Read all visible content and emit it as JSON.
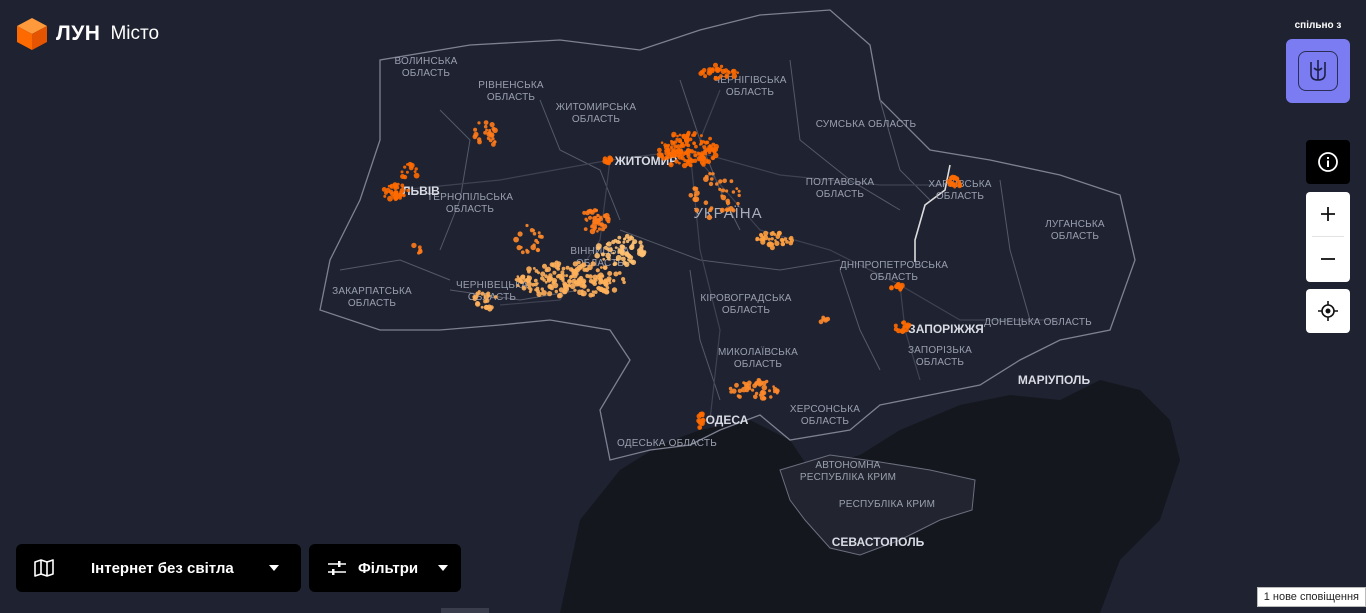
{
  "app": {
    "logo_text": "ЛУН",
    "logo_sub": "Місто",
    "brand_color": "#ff6a00"
  },
  "partner": {
    "label": "спільно з",
    "badge_color": "#7b7cf2",
    "emblem_icon": "trident-icon"
  },
  "controls": {
    "info_icon": "info-icon",
    "zoom_in_icon": "plus-icon",
    "zoom_out_icon": "minus-icon",
    "locate_icon": "crosshair-icon"
  },
  "bottom_bar": {
    "layer_label": "Інтернет без світла",
    "layer_icon": "map-icon",
    "filter_label": "Фільтри",
    "filter_icon": "sliders-icon"
  },
  "notification": "1 нове сповіщення",
  "map": {
    "country": "УКРАЇНА",
    "regions": [
      {
        "line1": "ВОЛИНСЬКА",
        "line2": "ОБЛАСТЬ"
      },
      {
        "line1": "РІВНЕНСЬКА",
        "line2": "ОБЛАСТЬ"
      },
      {
        "line1": "ЖИТОМИРСЬКА",
        "line2": "ОБЛАСТЬ"
      },
      {
        "line1": "ЧЕРНІГІВСЬКА",
        "line2": "ОБЛАСТЬ"
      },
      {
        "line1": "СУМСЬКА ОБЛАСТЬ",
        "line2": ""
      },
      {
        "line1": "ПОЛТАВСЬКА",
        "line2": "ОБЛАСТЬ"
      },
      {
        "line1": "ХАРКІВСЬКА",
        "line2": "ОБЛАСТЬ"
      },
      {
        "line1": "ЛУГАНСЬКА",
        "line2": "ОБЛАСТЬ"
      },
      {
        "line1": "ТЕРНОПІЛЬСЬКА",
        "line2": "ОБЛАСТЬ"
      },
      {
        "line1": "ВІННИЦЬКА",
        "line2": "ОБЛАСТЬ"
      },
      {
        "line1": "ЗАКАРПАТСЬКА",
        "line2": "ОБЛАСТЬ"
      },
      {
        "line1": "ЧЕРНІВЕЦЬКА",
        "line2": "ОБЛАСТЬ"
      },
      {
        "line1": "КІРОВОГРАДСЬКА",
        "line2": "ОБЛАСТЬ"
      },
      {
        "line1": "ДНІПРОПЕТРОВСЬКА",
        "line2": "ОБЛАСТЬ"
      },
      {
        "line1": "ДОНЕЦЬКА ОБЛАСТЬ",
        "line2": ""
      },
      {
        "line1": "ЗАПОРІЗЬКА",
        "line2": "ОБЛАСТЬ"
      },
      {
        "line1": "МИКОЛАЇВСЬКА",
        "line2": "ОБЛАСТЬ"
      },
      {
        "line1": "ХЕРСОНСЬКА",
        "line2": "ОБЛАСТЬ"
      },
      {
        "line1": "ОДЕСЬКА ОБЛАСТЬ",
        "line2": ""
      },
      {
        "line1": "АВТОНОМНА",
        "line2": "РЕСПУБЛІКА КРИМ"
      },
      {
        "line1": "РЕСПУБЛІКА КРИМ",
        "line2": ""
      }
    ],
    "cities": [
      "ЛЬВІВ",
      "ЖИТОМИР",
      "ЗАПОРІЖЖЯ",
      "МАРІУПОЛЬ",
      "ОДЕСА",
      "СЕВАСТОПОЛЬ"
    ]
  }
}
